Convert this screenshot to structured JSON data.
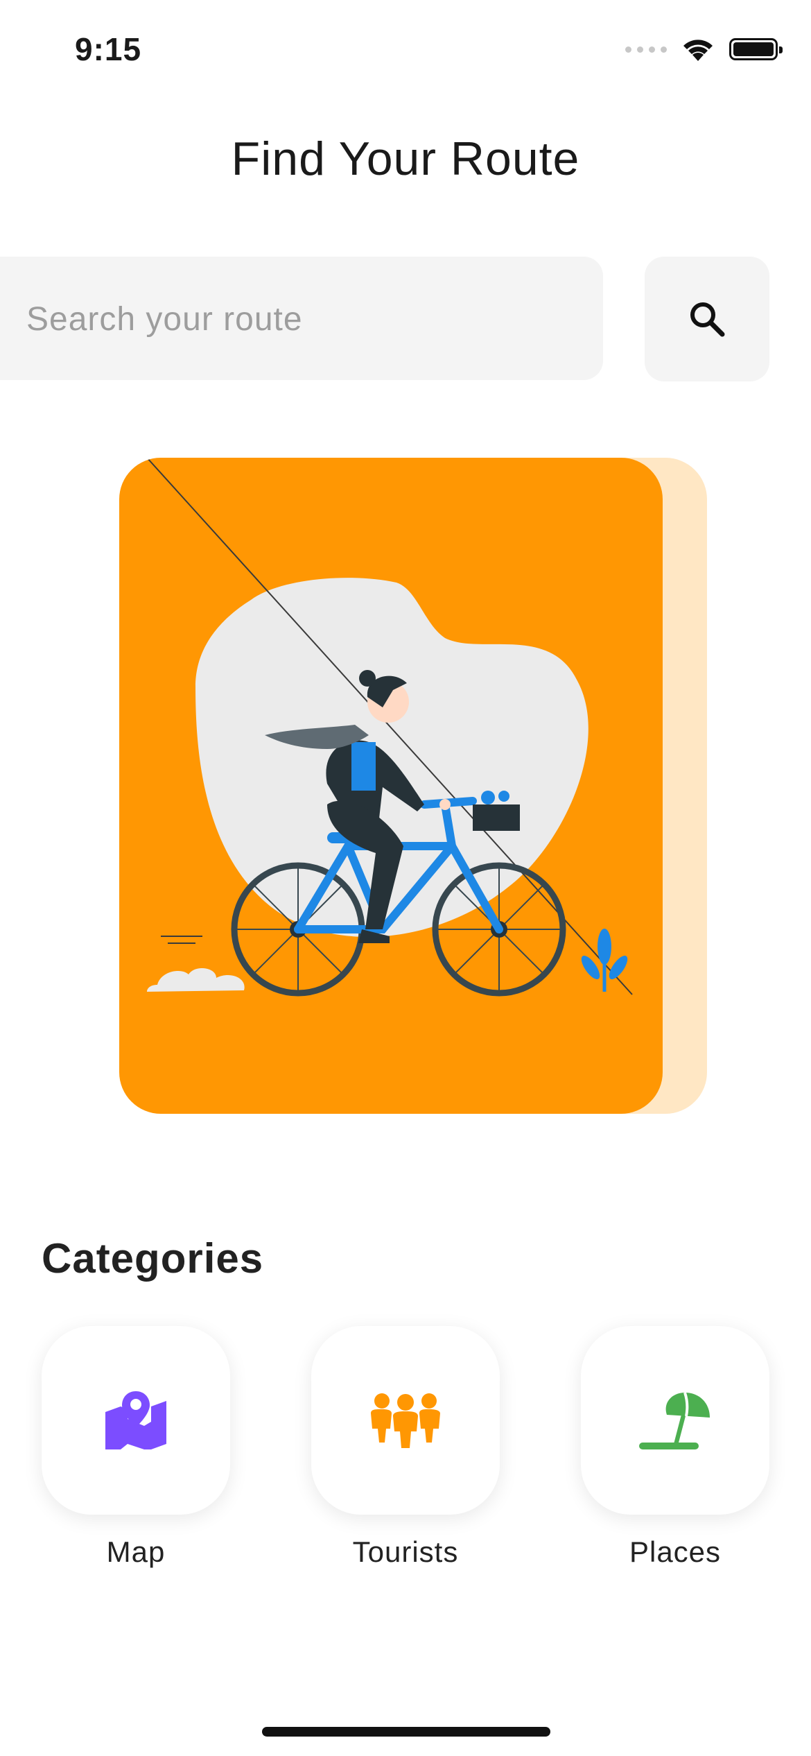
{
  "status_bar": {
    "time": "9:15"
  },
  "header": {
    "title": "Find Your Route"
  },
  "search": {
    "placeholder": "Search your route",
    "value": ""
  },
  "hero": {
    "illustration": "person riding a bicycle",
    "card_color": "#ff9703",
    "shadow_color": "#ffe7c4"
  },
  "categories": {
    "title": "Categories",
    "items": [
      {
        "label": "Map",
        "icon": "map-pin-icon",
        "color": "#7c4dff"
      },
      {
        "label": "Tourists",
        "icon": "people-group-icon",
        "color": "#ff9703"
      },
      {
        "label": "Places",
        "icon": "beach-umbrella-icon",
        "color": "#4caf50"
      }
    ]
  }
}
